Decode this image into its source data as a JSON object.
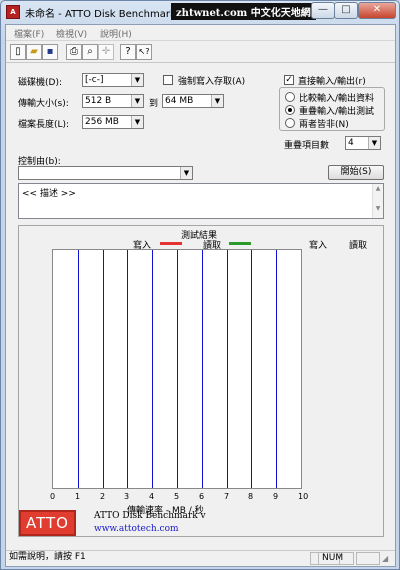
{
  "window": {
    "icon_label": "A",
    "title": "未命名 - ATTO Disk Benchmark",
    "watermark": "zhtwnet.com 中文化天地網",
    "minimize": "—",
    "maximize": "□",
    "close": "✕"
  },
  "menu": [
    "檔案(F)",
    "檢視(V)",
    "說明(H)"
  ],
  "toolbar": {
    "icons": [
      "new-file-icon",
      "open-folder-icon",
      "save-icon",
      "print-icon",
      "print-preview-icon",
      "move-icon",
      "help-icon",
      "context-help-icon"
    ],
    "glyphs": [
      "▯",
      "▰",
      "▪",
      "⎙",
      "⌕",
      "✛",
      "?",
      "↖?"
    ]
  },
  "settings": {
    "drive_label": "磁碟機(D):",
    "drive_value": "[-c-]",
    "force_write_label": "強制寫入存取(A)",
    "force_write_checked": false,
    "transfer_label": "傳輸大小(s):",
    "transfer_from": "512 B",
    "to_label": "到",
    "transfer_to": "64 MB",
    "file_length_label": "檔案長度(L):",
    "file_length": "256 MB",
    "direct_io_label": "直接輸入/輸出(r)",
    "direct_io_checked": true,
    "radio_compare": "比較輸入/輸出資料",
    "radio_overlap": "重疊輸入/輸出測試",
    "radio_neither": "兩者皆非(N)",
    "selected_radio": "overlap",
    "queue_label": "重疊項目數",
    "queue_value": "4",
    "controlled_by_label": "控制由(b):",
    "controlled_by_value": "",
    "start_button": "開始(S)",
    "description": "<< 描述 >>"
  },
  "results": {
    "title": "測試結果",
    "write_label": "寫入",
    "read_label": "讀取",
    "write_color": "#e53232",
    "read_color": "#2a9a2a",
    "col_write": "寫入",
    "col_read": "讀取",
    "x_axis_label": "傳輸速率 - MB / 秒",
    "x_ticks": [
      "0",
      "1",
      "2",
      "3",
      "4",
      "5",
      "6",
      "7",
      "8",
      "9",
      "10"
    ]
  },
  "chart_data": {
    "type": "bar",
    "xlabel": "傳輸速率 - MB / 秒",
    "xlim": [
      0,
      10
    ],
    "series": [
      {
        "name": "寫入",
        "values": []
      },
      {
        "name": "讀取",
        "values": []
      }
    ],
    "grid": true
  },
  "footer": {
    "logo_text": "ATTO",
    "product": "ATTO Disk Benchmark v",
    "url": "www.attotech.com"
  },
  "statusbar": {
    "help": "如需說明，請按 F1",
    "num": "NUM"
  }
}
